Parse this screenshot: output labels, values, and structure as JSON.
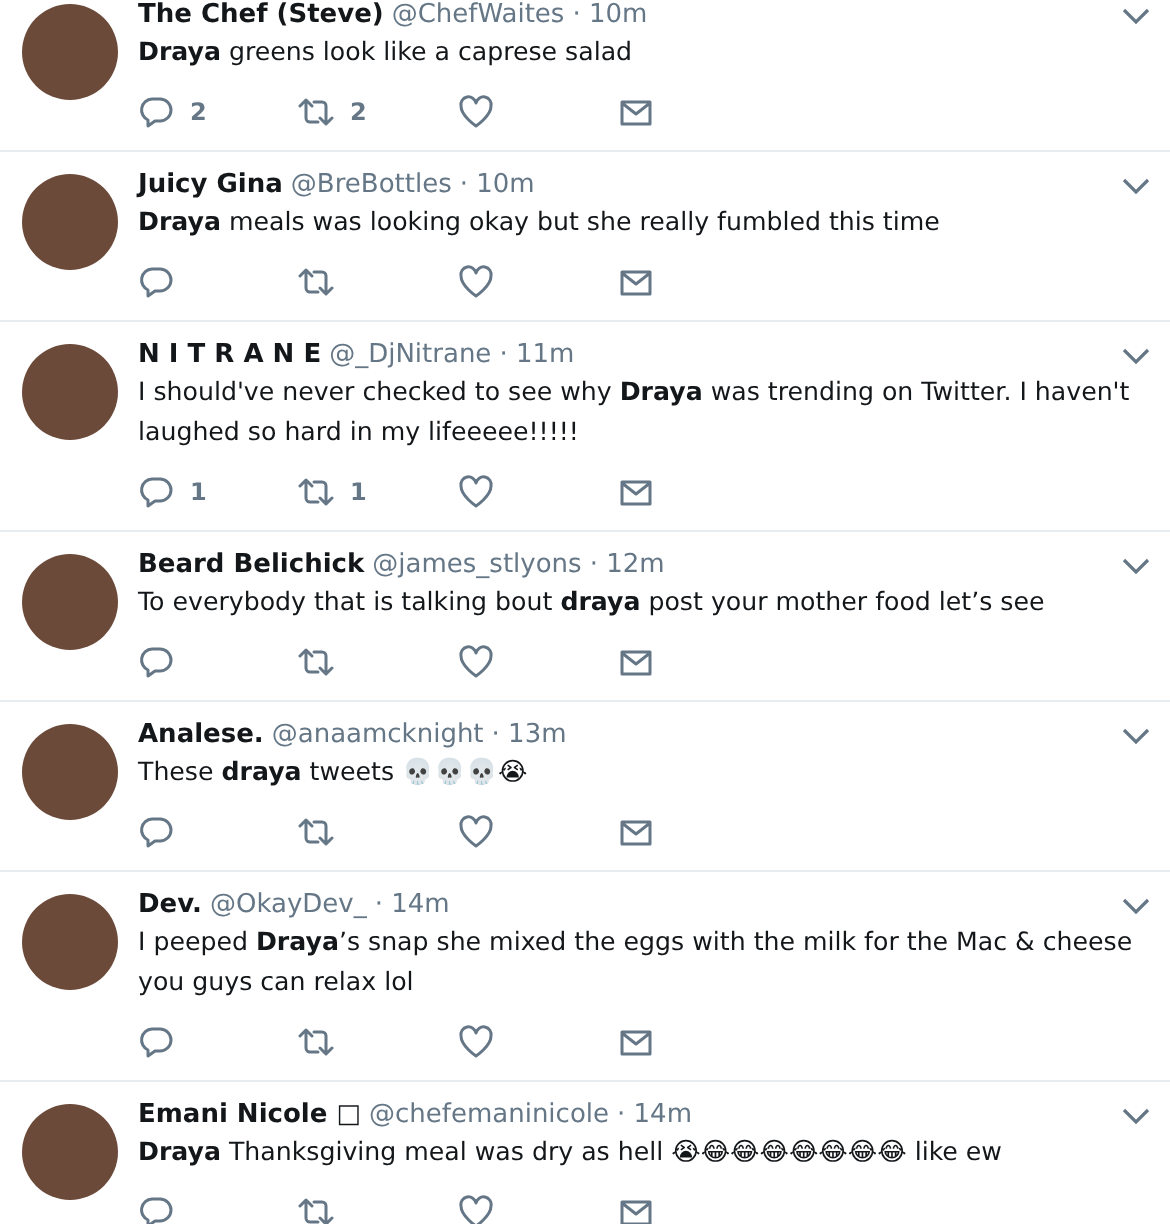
{
  "tweets": [
    {
      "name": "The Chef (Steve)",
      "handle": "@ChefWaites",
      "time": "· 10m",
      "text": "**Draya** greens look like a caprese salad",
      "replies": "2",
      "retweets": "2"
    },
    {
      "name": "Juicy Gina",
      "handle": "@BreBottles",
      "time": "· 10m",
      "text": "**Draya** meals was looking okay but she really fumbled this time"
    },
    {
      "name": "N I T R A N E",
      "handle": "@_DjNitrane",
      "time": "· 11m",
      "text": "I should've never checked to see why **Draya** was trending on Twitter. I haven't laughed so hard in my lifeeeee!!!!!",
      "replies": "1",
      "retweets": "1"
    },
    {
      "name": "Beard Belichick",
      "handle": "@james_stlyons",
      "time": "· 12m",
      "text": "To everybody that is talking bout **draya** post your mother food let’s see"
    },
    {
      "name": "Analese.",
      "handle": "@anaamcknight",
      "time": "· 13m",
      "text": "These **draya** tweets 💀💀💀😭"
    },
    {
      "name": "Dev.",
      "handle": "@OkayDev_",
      "time": "· 14m",
      "text": "I peeped **Draya**’s snap she mixed the eggs with the milk for the Mac & cheese you guys can relax lol"
    },
    {
      "name": "Emani Nicole □",
      "handle": "@chefemaninicole",
      "time": "· 14m",
      "text": "**Draya** Thanksgiving meal was dry as hell 😭😂😂😂😂😂😂😂 like ew"
    }
  ]
}
